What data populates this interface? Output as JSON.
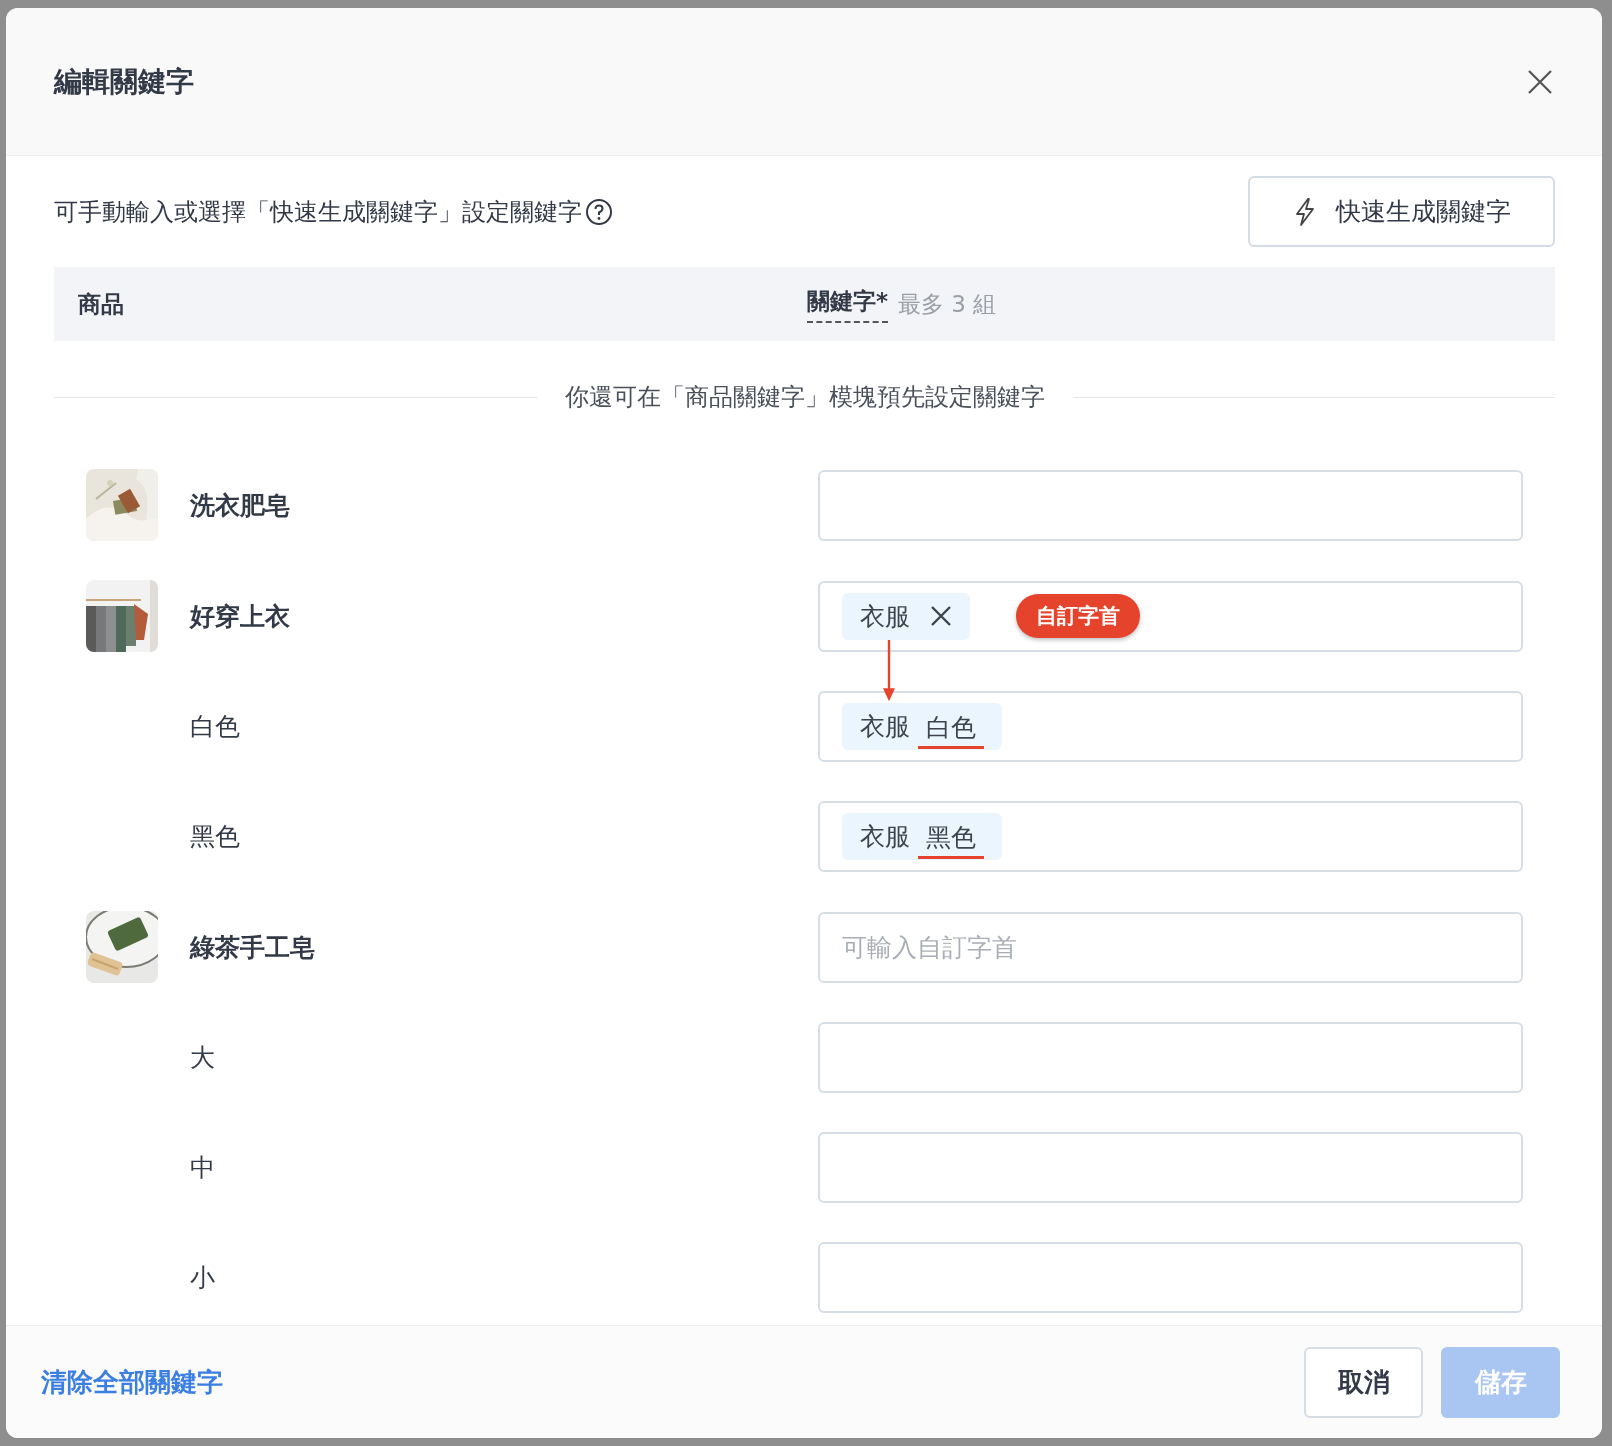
{
  "dialog": {
    "title": "編輯關鍵字",
    "instruction": "可手動輸入或選擇「快速生成關鍵字」設定關鍵字",
    "quick_button": "快速生成關鍵字",
    "table": {
      "columns": [
        {
          "label": "商品"
        },
        {
          "label": "關鍵字",
          "required_mark": "*",
          "hint": "最多 3 組"
        }
      ]
    },
    "divider_note": "你還可在「商品關鍵字」模塊預先設定關鍵字",
    "rows": [
      {
        "kind": "product",
        "name": "洗衣肥皂",
        "field": {}
      },
      {
        "kind": "product",
        "name": "好穿上衣",
        "field": {
          "tags": [
            {
              "text": "衣服",
              "removable": true
            }
          ],
          "badge": "自訂字首"
        }
      },
      {
        "kind": "variant",
        "name": "白色",
        "field": {
          "tags": [
            {
              "prefix": "衣服",
              "suffix": "白色"
            }
          ]
        }
      },
      {
        "kind": "variant",
        "name": "黑色",
        "field": {
          "tags": [
            {
              "prefix": "衣服",
              "suffix": "黑色"
            }
          ]
        }
      },
      {
        "kind": "product",
        "name": "綠茶手工皂",
        "field": {
          "placeholder": "可輸入自訂字首"
        }
      },
      {
        "kind": "variant",
        "name": "大",
        "field": {}
      },
      {
        "kind": "variant",
        "name": "中",
        "field": {}
      },
      {
        "kind": "variant",
        "name": "小",
        "field": {}
      }
    ],
    "footer": {
      "clear_link": "清除全部關鍵字",
      "buttons": [
        {
          "label": "取消",
          "kind": "secondary",
          "disabled": false
        },
        {
          "label": "儲存",
          "kind": "primary",
          "disabled": true
        }
      ]
    }
  }
}
